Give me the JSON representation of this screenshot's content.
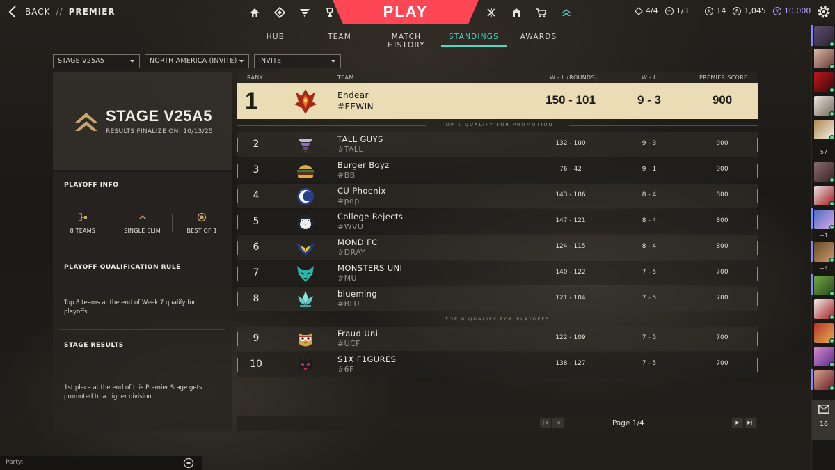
{
  "header": {
    "back_label": "BACK",
    "separator": "//",
    "section": "PREMIER",
    "play_label": "PLAY",
    "nav_left_icons": [
      "home-icon",
      "career-icon",
      "battlepass-icon",
      "esports-trophy-icon"
    ],
    "nav_right_icons": [
      "agents-icon",
      "collection-icon",
      "store-icon",
      "premier-icon"
    ],
    "currency": {
      "ticket": "4/4",
      "plus": "1/3",
      "kingdom": "14",
      "radianite": "1,045",
      "vp": "10,000"
    }
  },
  "tabs": [
    {
      "label": "HUB",
      "active": false
    },
    {
      "label": "TEAM",
      "active": false
    },
    {
      "label": "MATCH HISTORY",
      "active": false
    },
    {
      "label": "STANDINGS",
      "active": true
    },
    {
      "label": "AWARDS",
      "active": false
    }
  ],
  "filters": {
    "stage": "STAGE V25A5",
    "region": "NORTH AMERICA (INVITE)",
    "division": "INVITE"
  },
  "stage": {
    "title": "STAGE V25A5",
    "subtitle": "RESULTS FINALIZE ON: 10/13/25"
  },
  "playoff": {
    "info_title": "PLAYOFF INFO",
    "stats": [
      "8 TEAMS",
      "SINGLE ELIM",
      "BEST OF 1"
    ],
    "qual_title": "PLAYOFF QUALIFICATION RULE",
    "qual_text": "Top 8 teams at the end of Week 7 qualify for playoffs",
    "results_title": "STAGE RESULTS",
    "results_text": "1st place at the end of this Premier Stage gets promoted to a higher division"
  },
  "table": {
    "headers": {
      "rank": "RANK",
      "team": "TEAM",
      "wl_rounds": "W - L (ROUNDS)",
      "wl": "W - L",
      "score": "PREMIER SCORE"
    },
    "promotion_divider": "TOP 1 QUALIFY FOR PROMOTION",
    "playoff_divider": "TOP 8 QUALIFY FOR PLAYOFFS",
    "rows": [
      {
        "rank": "1",
        "name": "Endear",
        "tag": "#EEWIN",
        "wl_rounds": "150 - 101",
        "wl": "9 - 3",
        "score": "900",
        "emblem": "phoenix-emblem-icon"
      },
      {
        "rank": "2",
        "name": "TALL GUYS",
        "tag": "#TALL",
        "wl_rounds": "132 - 100",
        "wl": "9 - 3",
        "score": "900",
        "emblem": "tornado-emblem-icon"
      },
      {
        "rank": "3",
        "name": "Burger Boyz",
        "tag": "#BB",
        "wl_rounds": "76 - 42",
        "wl": "9 - 1",
        "score": "900",
        "emblem": "burger-emblem-icon"
      },
      {
        "rank": "4",
        "name": "CU Phoenix",
        "tag": "#pdp",
        "wl_rounds": "143 - 106",
        "wl": "8 - 4",
        "score": "800",
        "emblem": "crescent-emblem-icon"
      },
      {
        "rank": "5",
        "name": "College Rejects",
        "tag": "#WVU",
        "wl_rounds": "147 - 121",
        "wl": "8 - 4",
        "score": "800",
        "emblem": "penguin-emblem-icon"
      },
      {
        "rank": "6",
        "name": "MOND FC",
        "tag": "#DRAY",
        "wl_rounds": "124 - 115",
        "wl": "8 - 4",
        "score": "800",
        "emblem": "wings-emblem-icon"
      },
      {
        "rank": "7",
        "name": "MONSTERS UNI",
        "tag": "#MU",
        "wl_rounds": "140 - 122",
        "wl": "7 - 5",
        "score": "700",
        "emblem": "wolf-emblem-icon"
      },
      {
        "rank": "8",
        "name": "blueming",
        "tag": "#BLU",
        "wl_rounds": "121 - 104",
        "wl": "7 - 5",
        "score": "700",
        "emblem": "lotus-emblem-icon"
      },
      {
        "rank": "9",
        "name": "Fraud Uni",
        "tag": "#UCF",
        "wl_rounds": "122 - 109",
        "wl": "7 - 5",
        "score": "700",
        "emblem": "owl-emblem-icon"
      },
      {
        "rank": "10",
        "name": "S1X F1GURES",
        "tag": "#6F",
        "wl_rounds": "138 - 127",
        "wl": "7 - 5",
        "score": "700",
        "emblem": "cat-emblem-icon"
      }
    ]
  },
  "pagination": {
    "label": "Page 1/4"
  },
  "social": {
    "friends_count": "57",
    "party_a": "+1",
    "party_b": "+4",
    "mail_count": "16"
  },
  "party": {
    "label": "Party:"
  },
  "colors": {
    "accent_red": "#ff4655",
    "accent_teal": "#4dd8c3",
    "gold_highlight": "#eadcb4",
    "gold_line": "#ae8a4c",
    "online": "#4de3a2"
  }
}
